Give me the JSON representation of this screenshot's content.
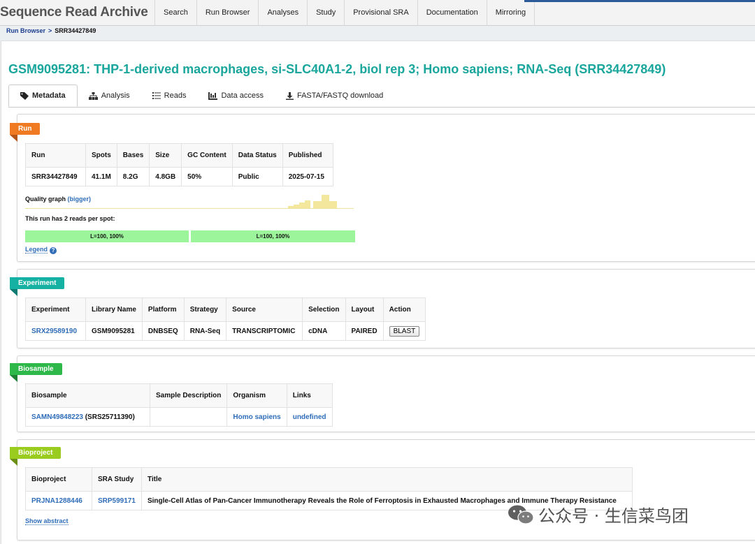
{
  "header": {
    "brand": "Sequence Read Archive",
    "nav": [
      "Search",
      "Run Browser",
      "Analyses",
      "Study",
      "Provisional SRA",
      "Documentation",
      "Mirroring"
    ]
  },
  "breadcrumb": {
    "root": "Run Browser",
    "separator": ">",
    "current": "SRR34427849"
  },
  "page_title": "GSM9095281: THP-1-derived macrophages, si-SLC40A1-2, biol rep 3; Homo sapiens; RNA-Seq (SRR34427849)",
  "tabs": [
    {
      "label": "Metadata",
      "icon": "tag-icon"
    },
    {
      "label": "Analysis",
      "icon": "sitemap-icon"
    },
    {
      "label": "Reads",
      "icon": "list-icon"
    },
    {
      "label": "Data access",
      "icon": "database-icon"
    },
    {
      "label": "FASTA/FASTQ download",
      "icon": "download-icon"
    }
  ],
  "run": {
    "ribbon": "Run",
    "color": "#ef7a22",
    "headers": [
      "Run",
      "Spots",
      "Bases",
      "Size",
      "GC Content",
      "Data Status",
      "Published"
    ],
    "row": [
      "SRR34427849",
      "41.1M",
      "8.2G",
      "4.8GB",
      "50%",
      "Public",
      "2025-07-15"
    ],
    "quality_label": "Quality graph",
    "quality_link": "(bigger)",
    "reads_text": "This run has 2 reads per spot:",
    "reads": [
      "L=100, 100%",
      "L=100, 100%"
    ],
    "legend_link": "Legend",
    "legend_help": "?"
  },
  "experiment": {
    "ribbon": "Experiment",
    "color": "#15b2a3",
    "headers": [
      "Experiment",
      "Library Name",
      "Platform",
      "Strategy",
      "Source",
      "Selection",
      "Layout",
      "Action"
    ],
    "row": [
      "SRX29589190",
      "GSM9095281",
      "DNBSEQ",
      "RNA-Seq",
      "TRANSCRIPTOMIC",
      "cDNA",
      "PAIRED"
    ],
    "action_button": "BLAST"
  },
  "biosample": {
    "ribbon": "Biosample",
    "color": "#2fb84a",
    "headers": [
      "Biosample",
      "Sample Description",
      "Organism",
      "Links"
    ],
    "accession": "SAMN49848223",
    "secondary": "(SRS25711390)",
    "description": "",
    "organism": "Homo sapiens",
    "links": "undefined"
  },
  "bioproject": {
    "ribbon": "Bioproject",
    "color": "#99cc1e",
    "headers": [
      "Bioproject",
      "SRA Study",
      "Title"
    ],
    "row": [
      "PRJNA1288446",
      "SRP599171",
      "Single-Cell Atlas of Pan-Cancer Immunotherapy Reveals the Role of Ferroptosis in Exhausted Macrophages and Immune Therapy Resistance"
    ],
    "abstract_link": "Show abstract"
  },
  "watermark": "公众号 · 生信菜鸟团"
}
